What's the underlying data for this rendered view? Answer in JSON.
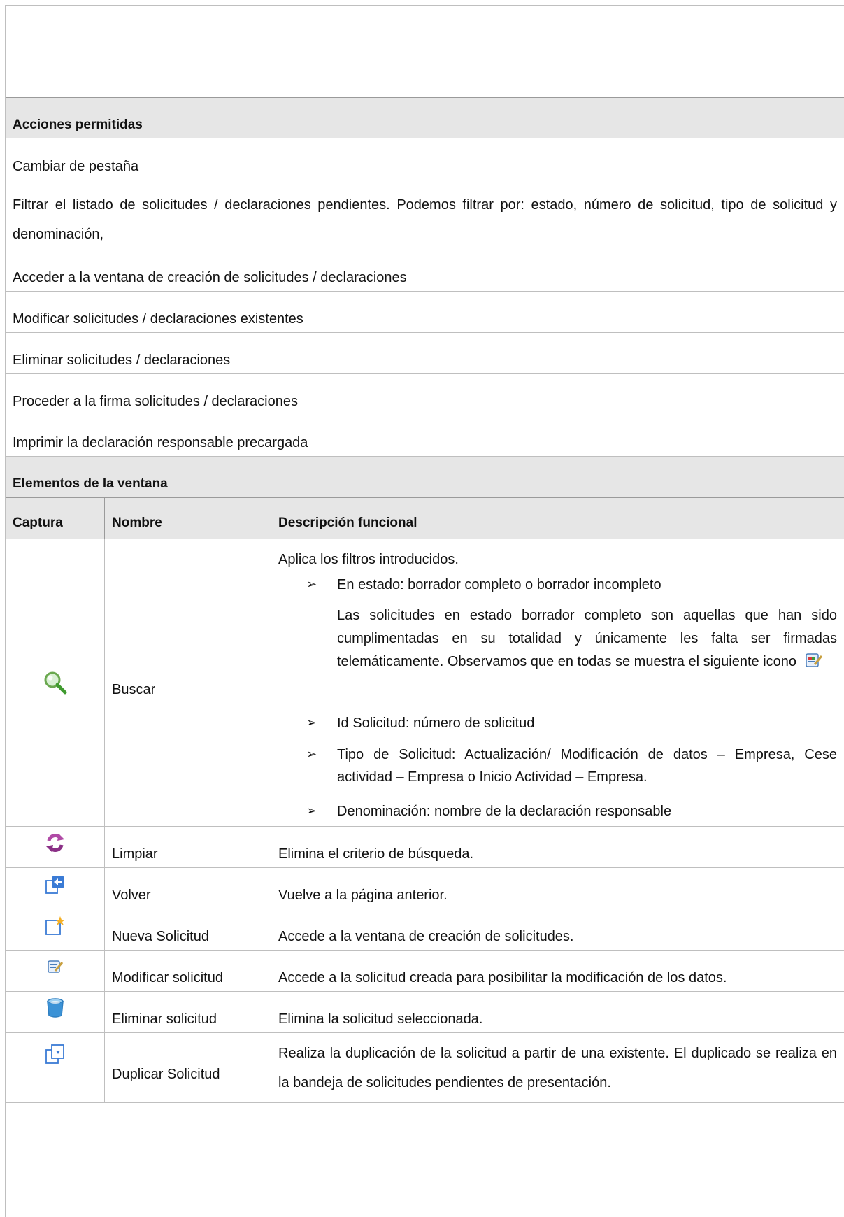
{
  "section_actions": {
    "title": "Acciones permitidas",
    "items": [
      "Cambiar de pestaña",
      "Filtrar el listado de solicitudes / declaraciones pendientes. Podemos filtrar por: estado, número de solicitud, tipo de solicitud y denominación,",
      "Acceder a la ventana de creación de solicitudes / declaraciones",
      "Modificar solicitudes / declaraciones existentes",
      "Eliminar solicitudes / declaraciones",
      "Proceder a la firma solicitudes / declaraciones",
      "Imprimir la declaración responsable precargada"
    ]
  },
  "section_elements": {
    "title": "Elementos de la ventana",
    "columns": [
      "Captura",
      "Nombre",
      "Descripción funcional"
    ],
    "buscar": {
      "name": "Buscar",
      "intro": "Aplica los filtros introducidos.",
      "bullet1": "En estado: borrador completo o borrador incompleto",
      "bullet1_detail": "Las solicitudes en estado borrador completo son aquellas que han sido cumplimentadas en su totalidad y únicamente les falta ser firmadas telemáticamente. Observamos que en todas se muestra el siguiente icono",
      "bullet2": "Id Solicitud: número de solicitud",
      "bullet3": "Tipo de Solicitud: Actualización/ Modificación de datos – Empresa, Cese actividad – Empresa o Inicio Actividad – Empresa.",
      "bullet4": "Denominación: nombre de la declaración responsable",
      "bullet_glyph": "➢"
    },
    "rows": [
      {
        "icon": "refresh-icon",
        "name": "Limpiar",
        "desc": "Elimina el criterio de búsqueda."
      },
      {
        "icon": "back-page-icon",
        "name": "Volver",
        "desc": "Vuelve a la página anterior."
      },
      {
        "icon": "new-document-icon",
        "name": "Nueva Solicitud",
        "desc": "Accede a la ventana de creación de solicitudes."
      },
      {
        "icon": "edit-document-icon",
        "name": "Modificar solicitud",
        "desc": "Accede a la solicitud creada para posibilitar la modificación de los datos."
      },
      {
        "icon": "trash-bin-icon",
        "name": "Eliminar solicitud",
        "desc": "Elimina la solicitud seleccionada."
      },
      {
        "icon": "duplicate-icon",
        "name": "Duplicar Solicitud",
        "desc": "Realiza la duplicación de la solicitud a partir de una existente. El duplicado se realiza en la bandeja de solicitudes pendientes de presentación."
      }
    ]
  }
}
